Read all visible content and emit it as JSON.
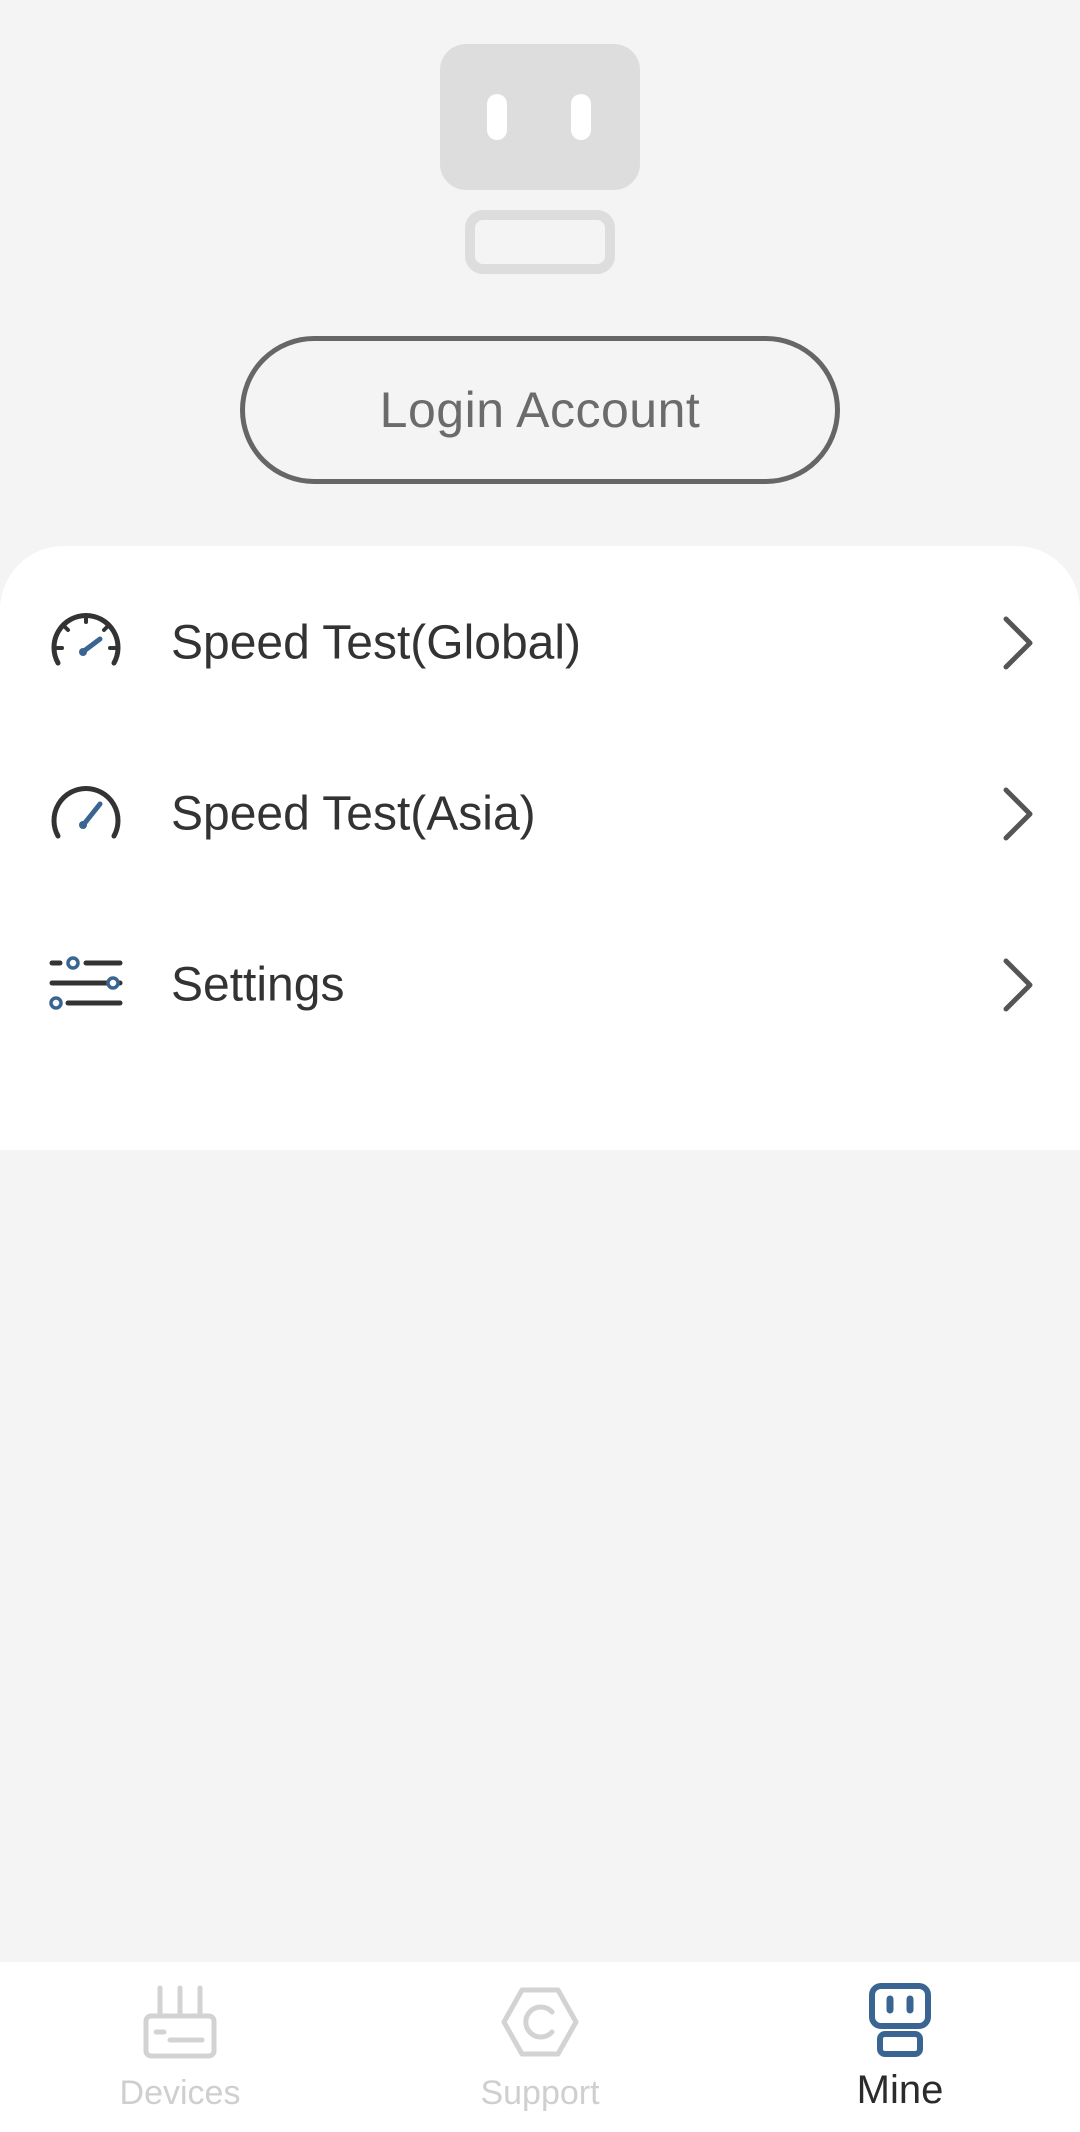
{
  "profile": {
    "login_label": "Login Account"
  },
  "menu": {
    "items": [
      {
        "label": "Speed Test(Global)",
        "icon": "speedometer-icon"
      },
      {
        "label": "Speed Test(Asia)",
        "icon": "gauge-icon"
      },
      {
        "label": "Settings",
        "icon": "sliders-icon"
      }
    ]
  },
  "tabbar": {
    "items": [
      {
        "label": "Devices",
        "icon": "router-icon",
        "active": false
      },
      {
        "label": "Support",
        "icon": "support-icon",
        "active": false
      },
      {
        "label": "Mine",
        "icon": "robot-face-icon",
        "active": true
      }
    ]
  },
  "colors": {
    "accent": "#3a6592",
    "background": "#f4f4f4",
    "card": "#ffffff",
    "text": "#333333",
    "inactive": "#cfcfcf"
  }
}
